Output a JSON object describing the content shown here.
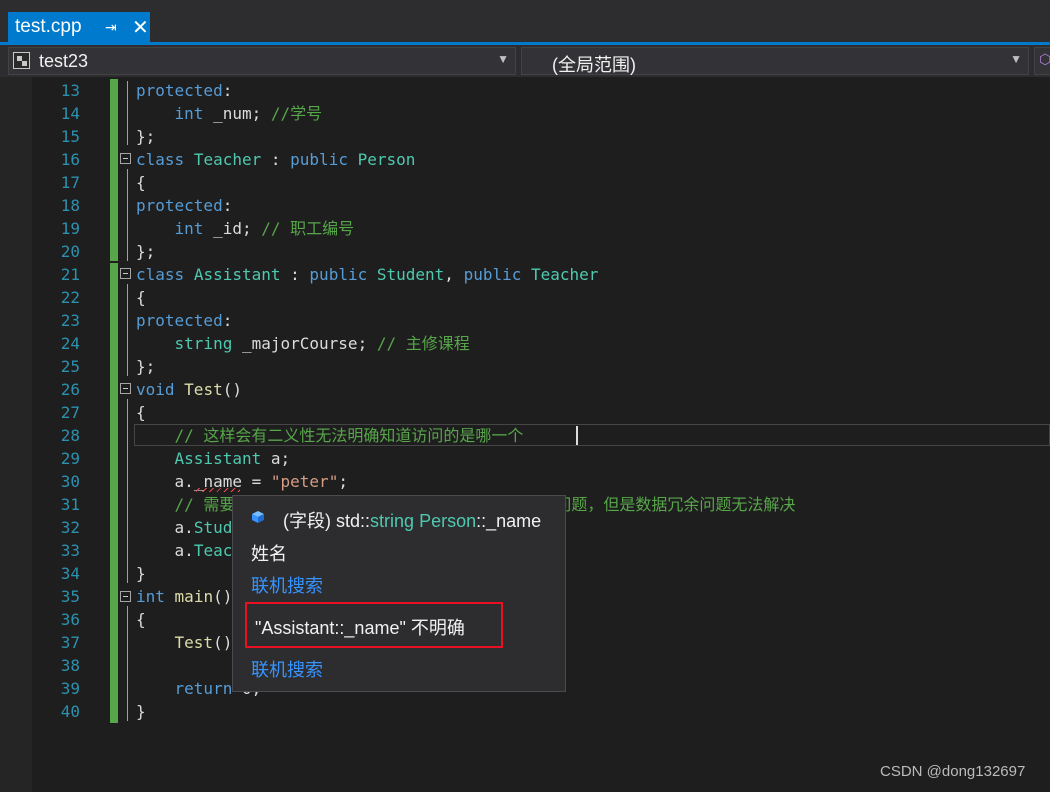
{
  "tab": {
    "title": "test.cpp",
    "pin_icon": "pin-icon",
    "close_icon": "close-icon"
  },
  "navbar": {
    "project": "test23",
    "scope": "(全局范围)"
  },
  "editor": {
    "line_numbers": [
      "13",
      "14",
      "15",
      "16",
      "17",
      "18",
      "19",
      "20",
      "21",
      "22",
      "23",
      "24",
      "25",
      "26",
      "27",
      "28",
      "29",
      "30",
      "31",
      "32",
      "33",
      "34",
      "35",
      "36",
      "37",
      "38",
      "39",
      "40"
    ],
    "lines": [
      "protected:",
      "    int _num; //学号",
      "};",
      "class Teacher : public Person",
      "{",
      "protected:",
      "    int _id; // 职工编号",
      "};",
      "class Assistant : public Student, public Teacher",
      "{",
      "protected:",
      "    string _majorCourse; // 主修课程",
      "};",
      "void Test()",
      "{",
      "    // 这样会有二义性无法明确知道访问的是哪一个",
      "    Assistant a;",
      "    a._name = \"peter\";",
      "    // 需要显示指定访问哪个父类的成员可以解决二义性问题，但是数据冗余问题无法解决",
      "    a.Student::_name = \"xxx\";",
      "    a.Teacher::_name = \"yyy\";",
      "}",
      "int main()",
      "{",
      "    Test();",
      "",
      "    return 0;",
      "}"
    ]
  },
  "popup": {
    "kind": "(字段)",
    "sig_ns": "std::",
    "sig_type": "string",
    "sig_space": " ",
    "sig_class": "Person",
    "sig_member": "::_name",
    "description": "姓名",
    "search_link": "联机搜索",
    "error": "\"Assistant::_name\" 不明确",
    "search_link2": "联机搜索"
  },
  "watermark": "CSDN @dong132697",
  "colors": {
    "accent": "#007acc",
    "keyword": "#569cd6",
    "type": "#4ec9b0",
    "comment": "#57a64a",
    "string": "#d69d85",
    "error": "#e81123"
  }
}
